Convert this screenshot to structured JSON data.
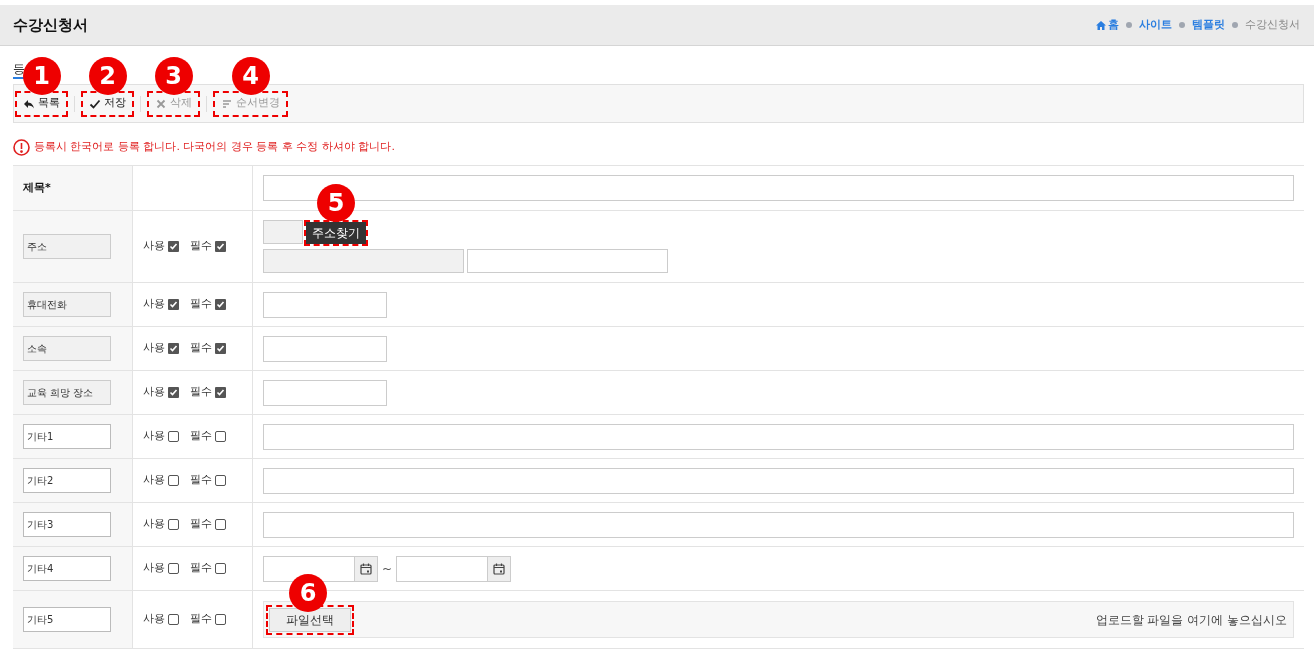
{
  "header": {
    "title": "수강신청서",
    "breadcrumb": [
      {
        "label": "홈",
        "kind": "home"
      },
      {
        "label": "사이트",
        "kind": "link"
      },
      {
        "label": "템플릿",
        "kind": "link"
      },
      {
        "label": "수강신청서",
        "kind": "current"
      }
    ]
  },
  "tab": {
    "label": "등"
  },
  "toolbar": [
    {
      "label": "목록",
      "kind": "back",
      "disabled": false,
      "marker": "1"
    },
    {
      "label": "저장",
      "kind": "check",
      "disabled": false,
      "marker": "2"
    },
    {
      "label": "삭제",
      "kind": "x",
      "disabled": true,
      "marker": "3"
    },
    {
      "label": "순서변경",
      "kind": "sort",
      "disabled": true,
      "marker": "4"
    }
  ],
  "notice": "등록시 한국어로 등록 합니다. 다국어의 경우 등록 후 수정 하셔야 합니다.",
  "rows": [
    {
      "kind": "title",
      "label": "제목*"
    },
    {
      "kind": "address",
      "label": "주소",
      "label_disabled": true,
      "use_label": "사용",
      "use": true,
      "req_label": "필수",
      "required": true,
      "button": "주소찾기",
      "marker": "5"
    },
    {
      "kind": "short",
      "label": "휴대전화",
      "label_disabled": true,
      "use_label": "사용",
      "use": true,
      "req_label": "필수",
      "required": true
    },
    {
      "kind": "short",
      "label": "소속",
      "label_disabled": true,
      "use_label": "사용",
      "use": true,
      "req_label": "필수",
      "required": true
    },
    {
      "kind": "short",
      "label": "교육 희망 장소",
      "label_disabled": true,
      "use_label": "사용",
      "use": true,
      "req_label": "필수",
      "required": true
    },
    {
      "kind": "long",
      "label": "기타1",
      "label_disabled": false,
      "use_label": "사용",
      "use": false,
      "req_label": "필수",
      "required": false
    },
    {
      "kind": "long",
      "label": "기타2",
      "label_disabled": false,
      "use_label": "사용",
      "use": false,
      "req_label": "필수",
      "required": false
    },
    {
      "kind": "long",
      "label": "기타3",
      "label_disabled": false,
      "use_label": "사용",
      "use": false,
      "req_label": "필수",
      "required": false
    },
    {
      "kind": "date",
      "label": "기타4",
      "label_disabled": false,
      "use_label": "사용",
      "use": false,
      "req_label": "필수",
      "required": false,
      "separator": "~"
    },
    {
      "kind": "file",
      "label": "기타5",
      "label_disabled": false,
      "use_label": "사용",
      "use": false,
      "req_label": "필수",
      "required": false,
      "button": "파일선택",
      "marker": "6",
      "drop_hint": "업로드할 파일을 여기에 놓으십시오"
    }
  ]
}
